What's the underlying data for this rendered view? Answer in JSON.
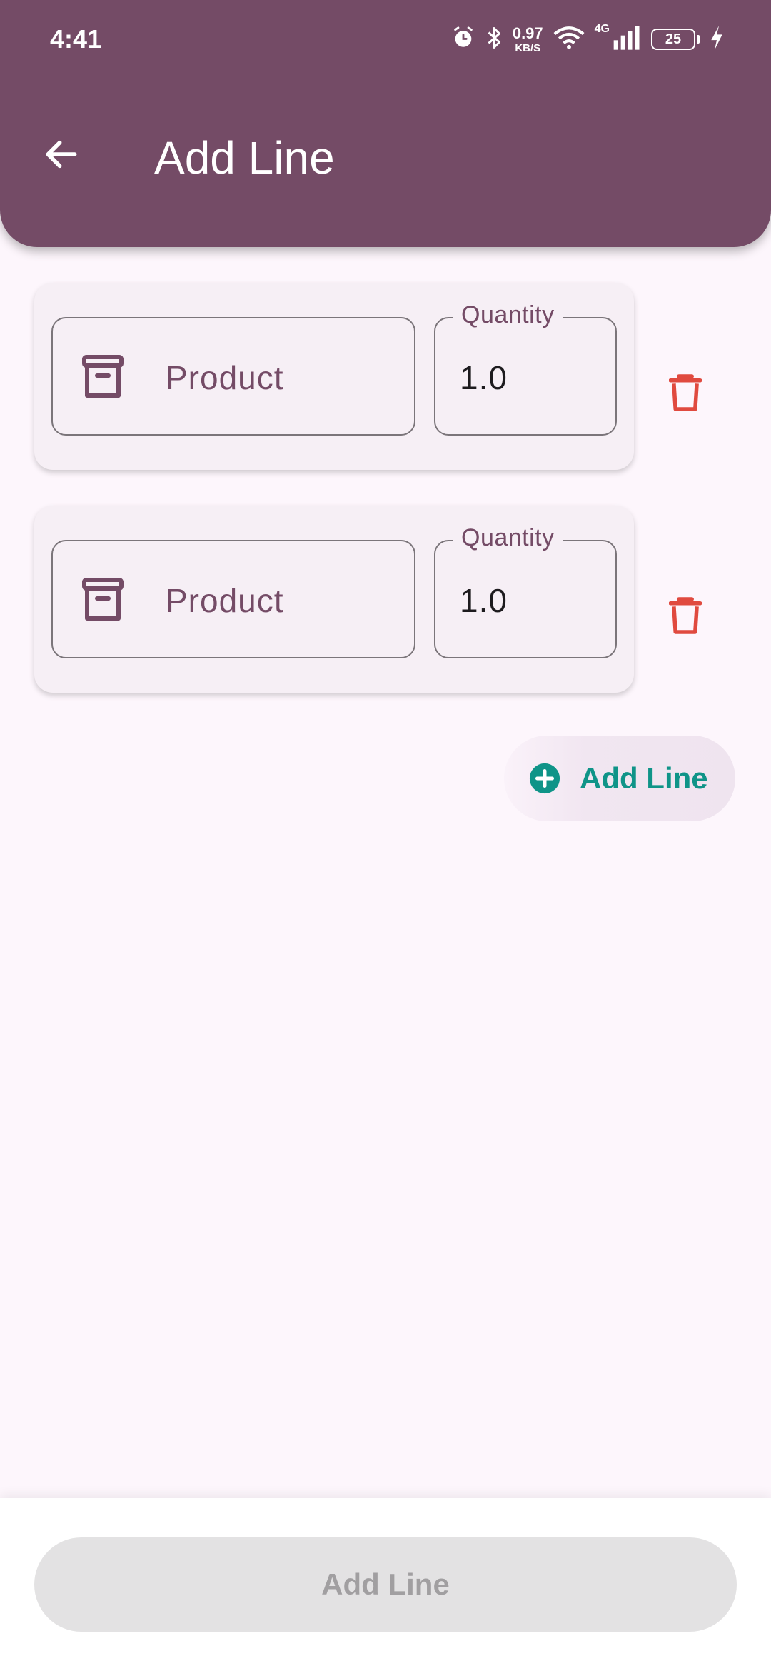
{
  "status_bar": {
    "time": "4:41",
    "speed_value": "0.97",
    "speed_unit": "KB/S",
    "network_type": "4G",
    "battery_level": "25"
  },
  "app_bar": {
    "title": "Add Line"
  },
  "lines": [
    {
      "product_label": "Product",
      "quantity_label": "Quantity",
      "quantity_value": "1.0"
    },
    {
      "product_label": "Product",
      "quantity_label": "Quantity",
      "quantity_value": "1.0"
    }
  ],
  "add_line_button": {
    "label": "Add Line"
  },
  "bottom_button": {
    "label": "Add Line"
  },
  "colors": {
    "primary": "#744b66",
    "accent": "#0f9488",
    "delete": "#e04a3f",
    "background": "#fdf6fc"
  },
  "icons": {
    "back": "arrow-left-icon",
    "product": "archive-box-icon",
    "delete": "trash-icon",
    "add": "plus-circle-icon"
  }
}
